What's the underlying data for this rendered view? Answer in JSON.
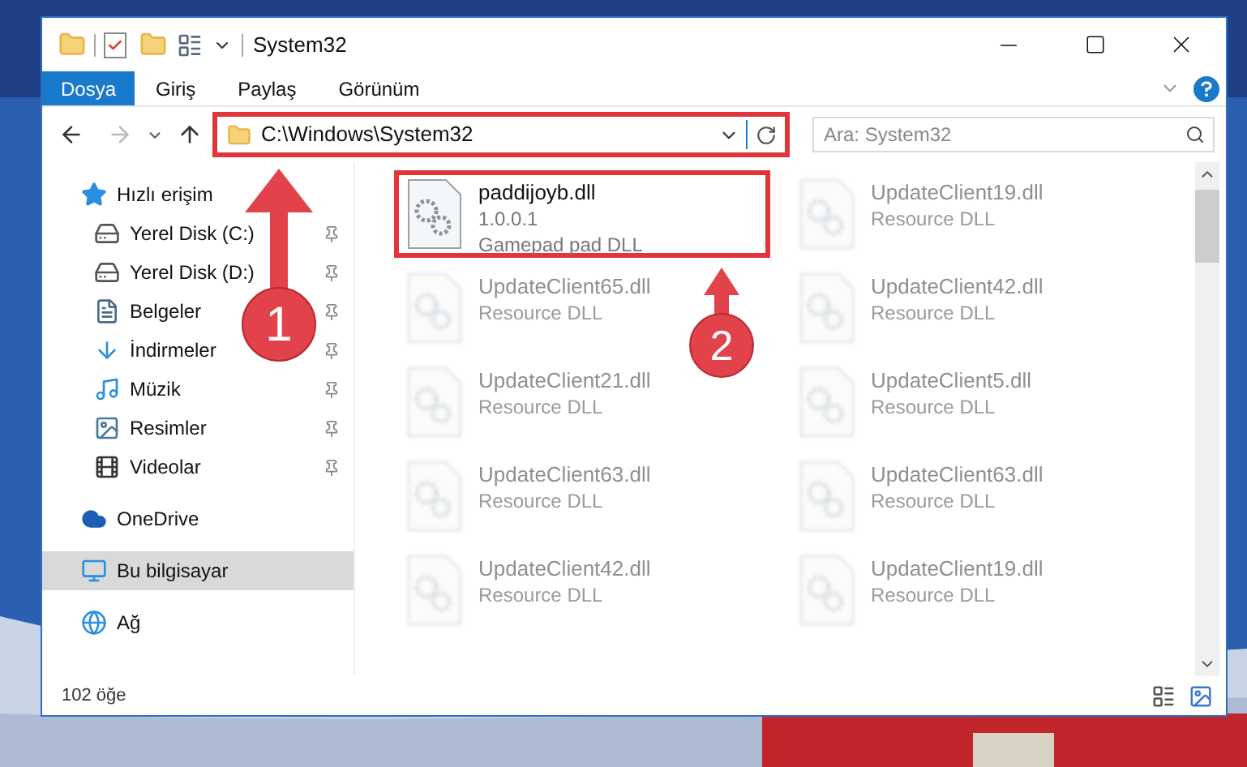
{
  "window": {
    "title": "System32"
  },
  "ribbon_tabs": [
    {
      "label": "Dosya",
      "selected": true
    },
    {
      "label": "Giriş",
      "selected": false
    },
    {
      "label": "Paylaş",
      "selected": false
    },
    {
      "label": "Görünüm",
      "selected": false
    }
  ],
  "address": {
    "path": "C:\\Windows\\System32",
    "highlighted": true
  },
  "search": {
    "placeholder": "Ara: System32"
  },
  "sidebar": {
    "items": [
      {
        "label": "Hızlı erişim",
        "kind": "star",
        "selected": false,
        "children": [
          {
            "label": "Yerel Disk (C:)",
            "kind": "system-drive",
            "pinned": true,
            "selected": false
          },
          {
            "label": "Yerel Disk (D:)",
            "kind": "drive",
            "pinned": true,
            "selected": false
          },
          {
            "label": "Belgeler",
            "kind": "documents",
            "pinned": true,
            "selected": false
          },
          {
            "label": "İndirmeler",
            "kind": "downloads",
            "pinned": true,
            "selected": false
          },
          {
            "label": "Müzik",
            "kind": "music",
            "pinned": true,
            "selected": false
          },
          {
            "label": "Resimler",
            "kind": "pictures",
            "pinned": true,
            "selected": false
          },
          {
            "label": "Videolar",
            "kind": "videos",
            "pinned": true,
            "selected": false
          }
        ]
      },
      {
        "label": "OneDrive",
        "kind": "cloud",
        "selected": false
      },
      {
        "label": "Bu bilgisayar",
        "kind": "computer",
        "selected": true
      },
      {
        "label": "Ağ",
        "kind": "network",
        "selected": false
      }
    ]
  },
  "files": [
    {
      "name": "paddijoyb.dll",
      "details": [
        "1.0.0.1",
        "Gamepad pad DLL"
      ],
      "highlighted": true,
      "blurred": false
    },
    {
      "name": "UpdateClient19.dll",
      "details": [
        "Resource DLL"
      ],
      "highlighted": false,
      "blurred": true
    },
    {
      "name": "UpdateClient65.dll",
      "details": [
        "Resource DLL"
      ],
      "highlighted": false,
      "blurred": true
    },
    {
      "name": "UpdateClient42.dll",
      "details": [
        "Resource DLL"
      ],
      "highlighted": false,
      "blurred": true
    },
    {
      "name": "UpdateClient21.dll",
      "details": [
        "Resource DLL"
      ],
      "highlighted": false,
      "blurred": true
    },
    {
      "name": "UpdateClient5.dll",
      "details": [
        "Resource DLL"
      ],
      "highlighted": false,
      "blurred": true
    },
    {
      "name": "UpdateClient63.dll",
      "details": [
        "Resource DLL"
      ],
      "highlighted": false,
      "blurred": true
    },
    {
      "name": "UpdateClient63.dll",
      "details": [
        "Resource DLL"
      ],
      "highlighted": false,
      "blurred": true
    },
    {
      "name": "UpdateClient42.dll",
      "details": [
        "Resource DLL"
      ],
      "highlighted": false,
      "blurred": true
    },
    {
      "name": "UpdateClient19.dll",
      "details": [
        "Resource DLL"
      ],
      "highlighted": false,
      "blurred": true
    }
  ],
  "status_bar": {
    "item_count": "102 öğe"
  },
  "annotations": [
    {
      "label": "1"
    },
    {
      "label": "2"
    }
  ]
}
